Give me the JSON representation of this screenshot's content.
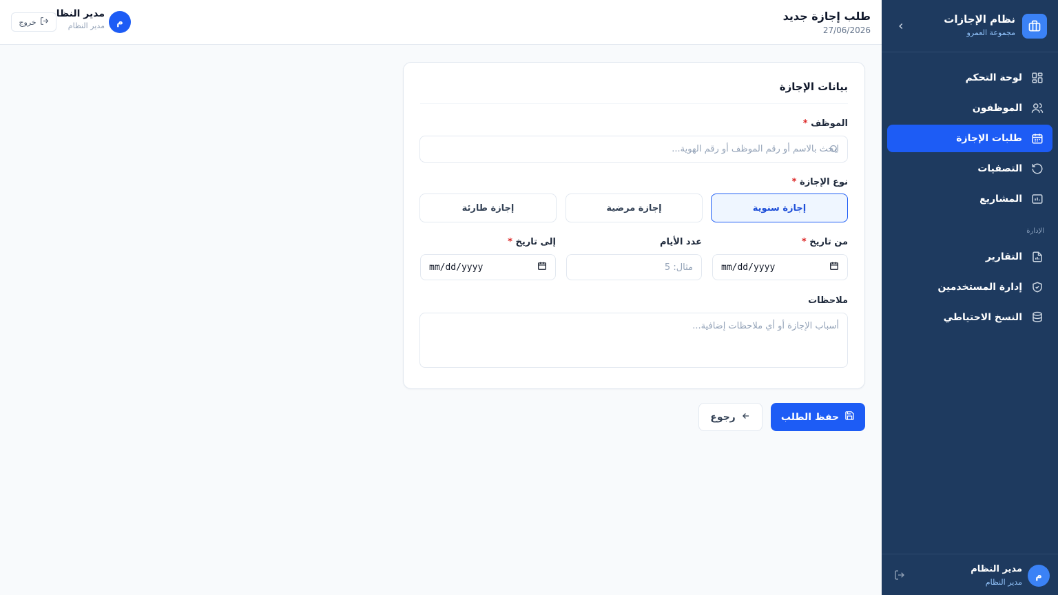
{
  "sidebar": {
    "app_title": "نظام الإجازات",
    "app_subtitle": "مجموعة العمرو",
    "items": [
      {
        "label": "لوحة التحكم",
        "icon": "dashboard-icon"
      },
      {
        "label": "الموظفون",
        "icon": "users-icon"
      },
      {
        "label": "طلبات الإجازة",
        "icon": "calendar-icon",
        "active": true
      },
      {
        "label": "التصفيات",
        "icon": "refresh-icon"
      },
      {
        "label": "المشاريع",
        "icon": "projects-icon"
      }
    ],
    "section_admin": "الإدارة",
    "admin_items": [
      {
        "label": "التقارير",
        "icon": "report-icon"
      },
      {
        "label": "إدارة المستخدمين",
        "icon": "shield-icon"
      },
      {
        "label": "النسخ الاحتياطي",
        "icon": "database-icon"
      }
    ],
    "footer": {
      "avatar": "م",
      "name": "مدير النظام",
      "role": "مدير النظام"
    }
  },
  "header": {
    "title": "طلب إجازة جديد",
    "date": "27/06/2026",
    "user": {
      "avatar": "م",
      "name": "مدير النظام",
      "role": "مدير النظام"
    },
    "logout_label": "خروج"
  },
  "form": {
    "card_title": "بيانات الإجازة",
    "employee": {
      "label": "الموظف",
      "required": "*",
      "placeholder": "ابحث بالاسم أو رقم الموظف أو رقم الهوية..."
    },
    "leave_type": {
      "label": "نوع الإجازة",
      "required": "*",
      "options": [
        "إجازة سنوية",
        "إجازة مرضية",
        "إجازة طارئة"
      ],
      "selected": "إجازة سنوية"
    },
    "from_date": {
      "label": "من تاريخ",
      "required": "*",
      "value": "mm/dd/yyyy"
    },
    "days": {
      "label": "عدد الأيام",
      "placeholder": "مثال: 5"
    },
    "to_date": {
      "label": "إلى تاريخ",
      "required": "*",
      "value": "mm/dd/yyyy"
    },
    "notes": {
      "label": "ملاحظات",
      "placeholder": "أسباب الإجازة أو أي ملاحظات إضافية..."
    }
  },
  "actions": {
    "save_label": "حفظ الطلب",
    "back_label": "رجوع"
  },
  "colors": {
    "sidebar_bg": "#1e3a5f",
    "accent": "#1d5cf5",
    "required": "#dc2626"
  }
}
